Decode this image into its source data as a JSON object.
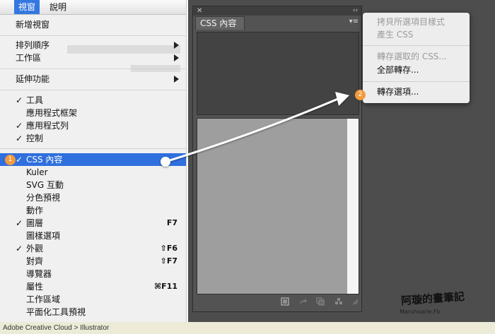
{
  "menubar": {
    "view": "視窗",
    "help": "說明"
  },
  "menu": {
    "new_window": "新增視窗",
    "arrange": "排列順序",
    "workspace": "工作區",
    "extensions": "延伸功能",
    "tools": "工具",
    "app_frame": "應用程式框架",
    "app_bar": "應用程式列",
    "control": "控制",
    "css_props": "CSS 內容",
    "kuler": "Kuler",
    "svg": "SVG 互動",
    "sep_preview": "分色預視",
    "actions": "動作",
    "layers": "圖層",
    "layers_sc": "F7",
    "graphic_styles": "圖樣選項",
    "appearance": "外觀",
    "appearance_sc": "⇧F6",
    "align": "對齊",
    "align_sc": "⇧F7",
    "navigator": "導覽器",
    "attributes": "屬性",
    "attributes_sc": "⌘F11",
    "artboards": "工作區域",
    "flattener": "平面化工具預視"
  },
  "check_glyph": "✓",
  "panel": {
    "close": "✕",
    "collapse": "‹‹",
    "tab": "CSS 內容",
    "menu_btn": "▾≡"
  },
  "flyout": {
    "copy_line1": "拷貝所選項目樣式",
    "copy_line2": "產生 CSS",
    "export_selected": "轉存選取的 CSS...",
    "export_all": "全部轉存...",
    "export_options": "轉存選項..."
  },
  "badges": {
    "one": "1",
    "two": "2"
  },
  "watermark": {
    "main": "阿璇的畫筆記",
    "sub": "Maruhoarie.Fb"
  },
  "caption": "Adobe Creative Cloud > Illustrator",
  "colors": {
    "highlight": "#2f6fde",
    "badge": "#f39b3c",
    "panel_bg": "#535353"
  }
}
